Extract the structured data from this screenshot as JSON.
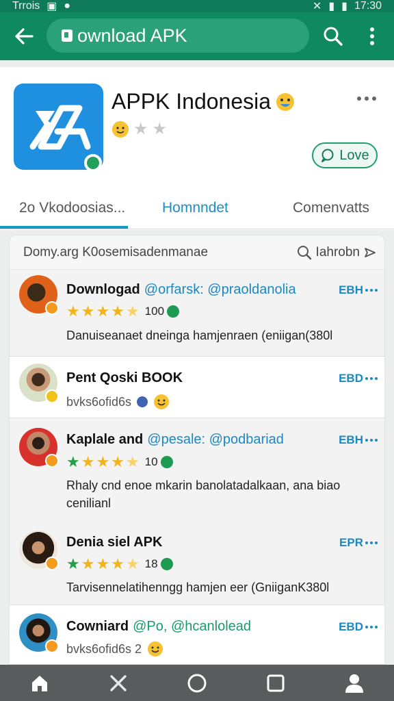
{
  "statusbar": {
    "left_text": "Trrois",
    "time": "17:30"
  },
  "appbar": {
    "search_text": "ownload APK"
  },
  "app": {
    "title": "APPK Indonesia",
    "love_label": "Love"
  },
  "tabs": [
    {
      "label": "2o Vkodoosias..."
    },
    {
      "label": "Homnndet"
    },
    {
      "label": "Comenvatts"
    }
  ],
  "panel": {
    "header_left": "Domy.arg K0osemisadenmanae",
    "header_right": "Iahrobn"
  },
  "reviews": [
    {
      "name": "Downlogad",
      "handle": "@orfarsk: @praoldanolia",
      "tag": "EBH",
      "rating": "100",
      "text": "Danuiseanaet dneinga hamjenraen (eniigan(380l"
    },
    {
      "name": "Pent Qoski BOOK",
      "handle": "",
      "tag": "EBD",
      "meta": "bvks6ofid6s"
    },
    {
      "name": "Kaplale and",
      "handle": "@pesale: @podbariad",
      "tag": "EBH",
      "rating": "10",
      "text": "Rhaly cnd enoe mkarin banolatadalkaan, ana biao cenilianl"
    },
    {
      "name": "Denia siel APK",
      "handle": "",
      "tag": "EPR",
      "rating": "18",
      "text": "Tarvisennelatihenngg hamjen eer (GniiganK380l"
    },
    {
      "name": "Cowniard",
      "handle": "@Po, @hcanlolead",
      "tag": "EBD",
      "meta": "bvks6ofid6s 2"
    }
  ],
  "colors": {
    "accent": "#0f8a60",
    "link": "#1a88c2",
    "star": "#f3b418"
  }
}
